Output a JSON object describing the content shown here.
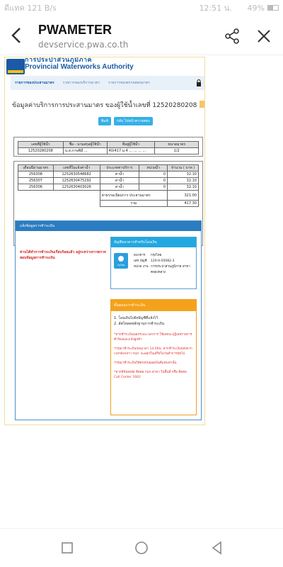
{
  "status_bar": {
    "left": "ดีแทค 121 B/s",
    "time": "12:51 น.",
    "battery": "49%",
    "battery_level": 0.49
  },
  "browser": {
    "title": "PWAMETER",
    "url": "devservice.pwa.co.th"
  },
  "site_header": {
    "org_thai": "การประปาส่วนภูมิภาค",
    "org_english": "Provincial Waterworks Authority"
  },
  "nav": {
    "tabs": [
      "รายการของประสานมาตร",
      "รายการของบริการมาตร",
      "รายการของตรวจสอบมาตร"
    ]
  },
  "form": {
    "title": "ข้อมูลค่าบริการการประสานมาตร ของผู้ใช้น้ำเลขที่ 12520280208",
    "print_button": "พิมพ์",
    "back_button": "กลับ ไปหน้าตรวจสอบ"
  },
  "table1": {
    "headers": [
      "เลขที่ผู้ใช้น้ำ",
      "ชื่อ - นามสกุลผู้ใช้น้ำ",
      "ที่อยู่ผู้ใช้น้ำ",
      "ขนาดมาตร"
    ],
    "row": [
      "12520280208",
      "น.ส.ภาษพิมี ...",
      "40/417 ม.4 ... ... ... ...",
      "1/2"
    ]
  },
  "table2": {
    "headers": [
      "เดือนปีอ่านมาตร",
      "เลขที่ใบแจ้งค่าน้ำ",
      "ประเภทค่าบริการ",
      "หน่วยน้ำ",
      "จำนวน ( บาท )"
    ],
    "rows": [
      [
        "256308",
        "1252630548682",
        "ค่าน้ำ",
        "0",
        "32.10"
      ],
      [
        "256307",
        "1252630475292",
        "ค่าน้ำ",
        "0",
        "32.10"
      ],
      [
        "256306",
        "1252630403026",
        "ค่าน้ำ",
        "0",
        "32.10"
      ]
    ],
    "fee_label": "ค่าธรรมเนียมการ ประสานมาตร",
    "fee_value": "321.00",
    "total_label": "รวม",
    "total_value": "417.30"
  },
  "payment": {
    "header": "แจ้งข้อมูลการชำระเงิน",
    "warning": "ท่านได้ทำการชำระเงินเรียบร้อยแล้ว อยู่ระหว่างการตรวจสอบข้อมูลการชำระเงิน",
    "bank_box": {
      "title": "บัญชีธนาคารสำหรับโอนเงิน",
      "logo_text": "กรุงไทย",
      "rows": [
        [
          "ธนาคาร",
          "กรุงไทย"
        ],
        [
          "เลข บัญชี",
          "120-0-05082-3"
        ],
        [
          "หน่วย งาน",
          "การประปาส่วนภูมิภาค สาขาคลองหลวง"
        ]
      ]
    },
    "steps_box": {
      "title": "ขั้นตอนการชำระเงิน",
      "steps": [
        "1. โอนเงินไปยังบัญชีที่แจ้งไว้",
        "2. อัพโหลดหลักฐานการชำระเงิน"
      ],
      "notes": [
        "*หากชำระเงินนอกระยะเวลาการ ใช้เลขจะปฏิเสธรายการคำร้องและแจ้งลูกค้า",
        "*กรุณาชำระเงินก่อนเวลา 14.00น. หากชำระเงินหลังจากเวลาดังกล่าว กปภ. จะออกใบเสร็จในวันทำการถัดไป",
        "*กรุณาชำระเงินให้ตรงกับยอดเงินที่แจ้งเท่านั้น",
        "*หากมีข้อสงสัย ติดต่อ กปภ.สาขา ในพื้นที่ หรือ ติดต่อ Call Center 1662"
      ]
    }
  }
}
